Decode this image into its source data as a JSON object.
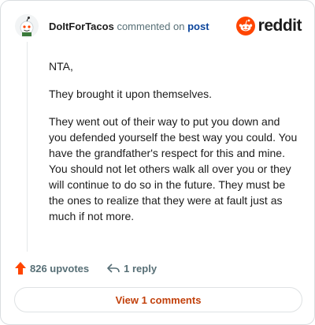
{
  "header": {
    "username": "DoItForTacos",
    "action_text": "commented on",
    "post_link": "post",
    "brand": "reddit"
  },
  "comment": {
    "paragraphs": [
      "NTA,",
      "They brought it upon themselves.",
      "They went out of their way to put you down and you defended yourself the best way you could. You have the grandfather's respect for this and mine. You should not let others walk all over you or they will continue to do so in the future. They must be the ones to realize that they were at fault just as much if not more."
    ]
  },
  "actions": {
    "upvotes": "826 upvotes",
    "replies": "1 reply"
  },
  "view_button": "View 1 comments",
  "colors": {
    "brand_orange": "#ff4500",
    "link_blue": "#0a449b",
    "view_text": "#c2410c"
  },
  "icons": [
    "snoo-avatar-icon",
    "reddit-logo-icon",
    "upvote-arrow-icon",
    "reply-arrow-icon"
  ]
}
